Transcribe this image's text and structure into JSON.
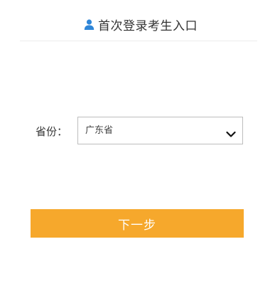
{
  "header": {
    "icon": "user-icon",
    "title": "首次登录考生入口"
  },
  "form": {
    "province_label": "省份：",
    "province_select": {
      "selected": "广东省",
      "icon": "chevron-down-icon"
    }
  },
  "actions": {
    "next_label": "下一步"
  },
  "colors": {
    "accent_button": "#f6a82c",
    "icon_blue": "#2f86d8"
  }
}
